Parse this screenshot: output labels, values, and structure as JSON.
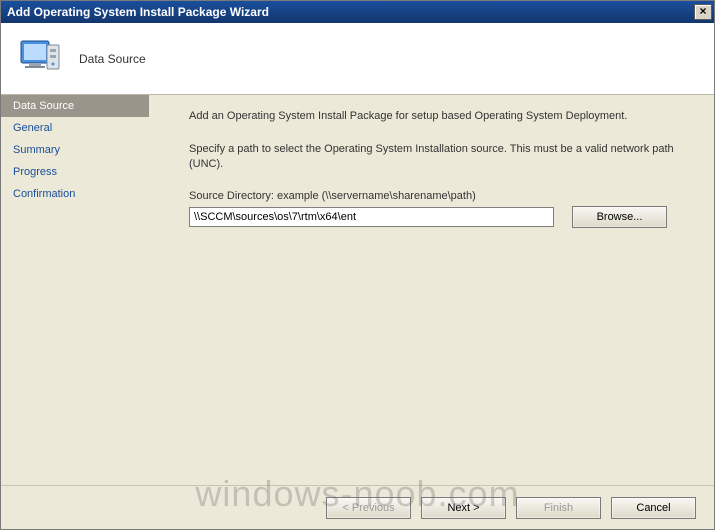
{
  "window": {
    "title": "Add Operating System Install Package Wizard",
    "close_label": "×"
  },
  "banner": {
    "page_title": "Data Source"
  },
  "sidebar": {
    "items": [
      {
        "label": "Data Source",
        "selected": true
      },
      {
        "label": "General",
        "selected": false
      },
      {
        "label": "Summary",
        "selected": false
      },
      {
        "label": "Progress",
        "selected": false
      },
      {
        "label": "Confirmation",
        "selected": false
      }
    ]
  },
  "content": {
    "intro": "Add an Operating System Install Package for setup based Operating System Deployment.",
    "instruction": "Specify a path to select the Operating System Installation source. This must be a valid network path (UNC).",
    "field_label": "Source Directory: example (\\\\servername\\sharename\\path)",
    "path_value": "\\\\SCCM\\sources\\os\\7\\rtm\\x64\\ent",
    "browse_label": "Browse..."
  },
  "buttons": {
    "previous": "< Previous",
    "next": "Next >",
    "finish": "Finish",
    "cancel": "Cancel"
  },
  "watermark": "windows-noob.com"
}
